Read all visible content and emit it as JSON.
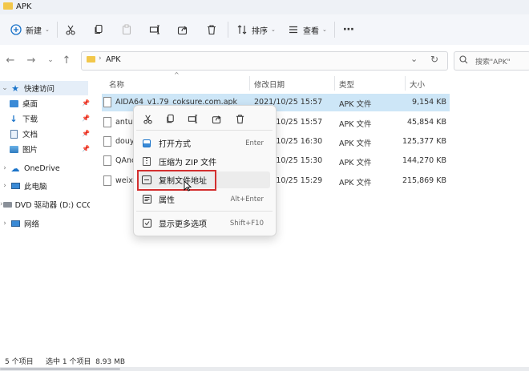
{
  "window": {
    "title": "APK"
  },
  "toolbar": {
    "new_label": "新建",
    "sort_label": "排序",
    "view_label": "查看"
  },
  "address": {
    "path": "APK",
    "search_placeholder": "搜索\"APK\""
  },
  "nav": {
    "quick_access": "快速访问",
    "items": [
      "桌面",
      "下载",
      "文档",
      "图片"
    ],
    "onedrive": "OneDrive",
    "this_pc": "此电脑",
    "dvd": "DVD 驱动器 (D:) CCC",
    "network": "网络"
  },
  "columns": {
    "name": "名称",
    "date": "修改日期",
    "type": "类型",
    "size": "大小"
  },
  "files": [
    {
      "name": "AIDA64_v1.79_coksure.com.apk",
      "date": "2021/10/25 15:57",
      "type": "APK 文件",
      "size": "9,154 KB"
    },
    {
      "name": "antut",
      "date": "2021/10/25 15:57",
      "type": "APK 文件",
      "size": "45,854 KB"
    },
    {
      "name": "douy",
      "date": "2021/10/25 16:30",
      "type": "APK 文件",
      "size": "125,377 KB"
    },
    {
      "name": "QAnc",
      "date": "2021/10/25 15:30",
      "type": "APK 文件",
      "size": "144,270 KB"
    },
    {
      "name": "weixi",
      "date": "2021/10/25 15:29",
      "type": "APK 文件",
      "size": "215,869 KB"
    }
  ],
  "context_menu": {
    "open_with": "打开方式",
    "open_with_shortcut": "Enter",
    "compress_zip": "压缩为 ZIP 文件",
    "copy_path": "复制文件地址",
    "properties": "属性",
    "properties_shortcut": "Alt+Enter",
    "more_options": "显示更多选项",
    "more_options_shortcut": "Shift+F10"
  },
  "status": {
    "count": "5 个项目",
    "selected": "选中 1 个项目  8.93 MB"
  },
  "colors": {
    "accent": "#1a73c9",
    "selection": "#cde6f7",
    "highlight": "#d32f2f",
    "folder": "#f2c74a"
  }
}
